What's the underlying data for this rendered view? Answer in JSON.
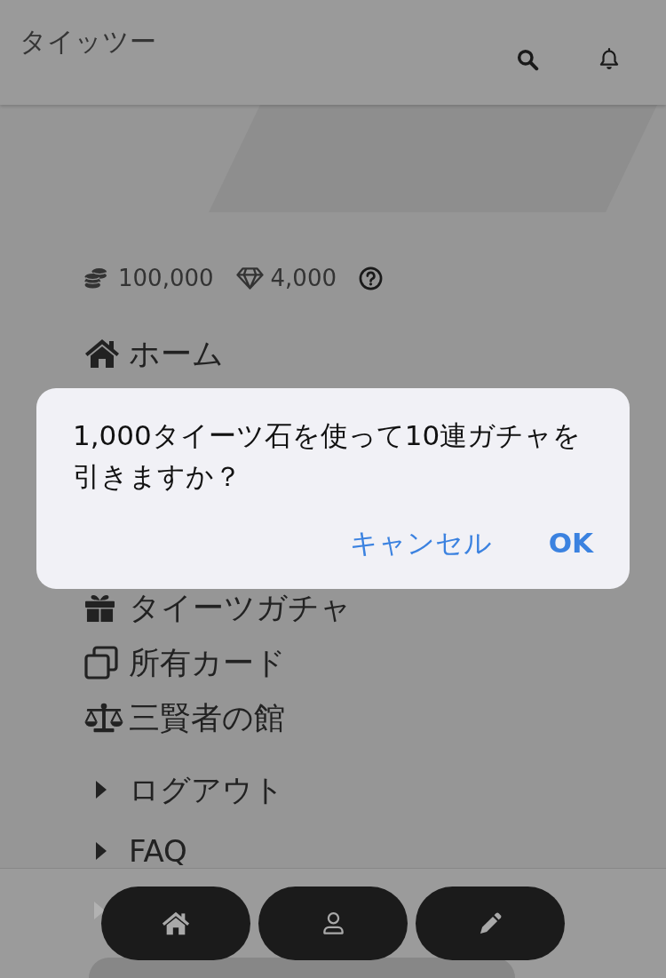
{
  "header": {
    "title": "タイッツー"
  },
  "wallet": {
    "coins": "100,000",
    "gems": "4,000"
  },
  "menu": {
    "items": [
      {
        "label": "ホーム"
      },
      {
        "label": "タイーツガチャ"
      },
      {
        "label": "所有カード"
      },
      {
        "label": "三賢者の館"
      }
    ],
    "links": [
      {
        "label": "ログアウト"
      },
      {
        "label": "FAQ"
      }
    ]
  },
  "dialog": {
    "message": "1,000タイーツ石を使って10連ガチャを引きますか？",
    "buttons": [
      {
        "label": "キャンセル",
        "kind": "cancel"
      },
      {
        "label": "OK",
        "kind": "default"
      }
    ]
  }
}
